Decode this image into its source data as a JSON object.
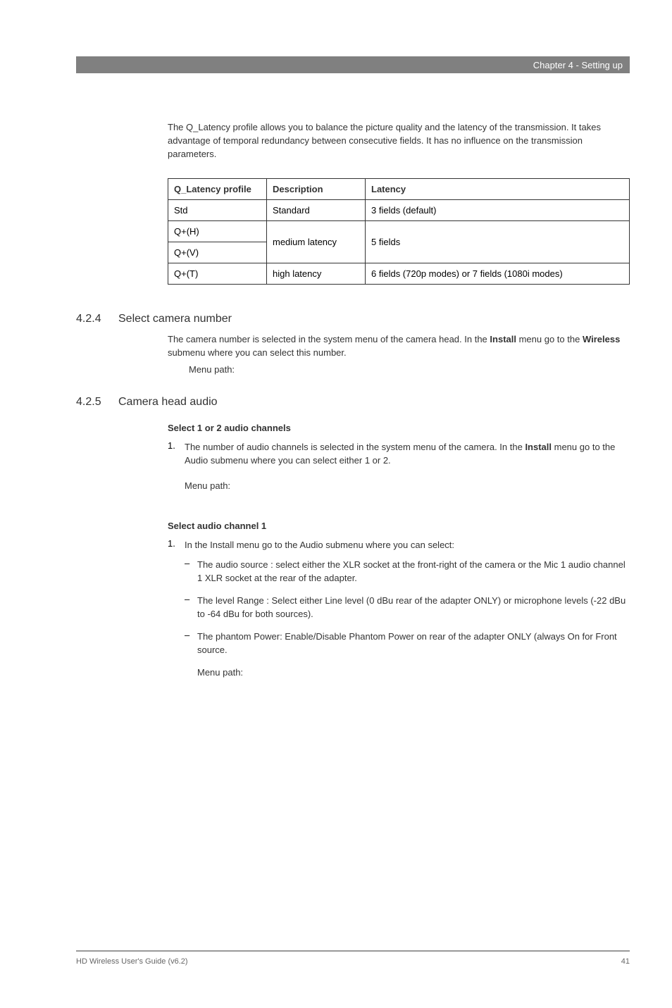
{
  "header": {
    "chapter": "Chapter 4 - Setting up"
  },
  "intro": "The Q_Latency profile allows you to balance the picture quality and the latency of the transmission. It takes advantage of temporal redundancy between consecutive fields. It has no influence on the transmission parameters.",
  "table": {
    "headers": {
      "profile": "Q_Latency profile",
      "description": "Description",
      "latency": "Latency"
    },
    "rows": [
      {
        "profile": "Std",
        "description": "Standard",
        "latency": "3 fields (default)"
      },
      {
        "profile": "Q+(H)",
        "description": "medium latency",
        "latency": "5 fields"
      },
      {
        "profile": "Q+(V)",
        "description": "medium latency",
        "latency": "5 fields"
      },
      {
        "profile": "Q+(T)",
        "description": "high latency",
        "latency": "6 fields (720p modes) or 7 fields (1080i modes)"
      }
    ]
  },
  "section_424": {
    "number": "4.2.4",
    "title": "Select camera number",
    "body_pre": "The camera number is selected in the system menu of the camera head. In the ",
    "body_bold1": "Install",
    "body_mid": " menu go to the ",
    "body_bold2": "Wireless",
    "body_post": " submenu where you can select this number.",
    "menu_path": "Menu path:"
  },
  "section_425": {
    "number": "4.2.5",
    "title": "Camera head audio",
    "sub1_title": "Select 1 or 2 audio channels",
    "sub1_item_num": "1.",
    "sub1_item_pre": "The number of audio channels is selected in the system menu of the camera. In the ",
    "sub1_item_bold": "Install",
    "sub1_item_post": " menu go to the Audio submenu where you can select either 1 or 2.",
    "sub1_menu_path": "Menu path:",
    "sub2_title": "Select audio channel 1",
    "sub2_item_num": "1.",
    "sub2_item_text": "In the Install menu go to the Audio submenu where you can select:",
    "bullets": [
      "The audio source : select either the XLR socket at the front-right of the camera or the Mic 1 audio channel 1 XLR socket at the rear of the adapter.",
      "The level Range : Select either Line level (0 dBu rear of the adapter ONLY) or microphone levels (-22 dBu to -64 dBu for both sources).",
      "The phantom Power: Enable/Disable Phantom Power on rear of the adapter ONLY (always On for Front source."
    ],
    "sub2_menu_path": "Menu path:"
  },
  "footer": {
    "left": "HD Wireless User's Guide (v6.2)",
    "right": "41"
  }
}
